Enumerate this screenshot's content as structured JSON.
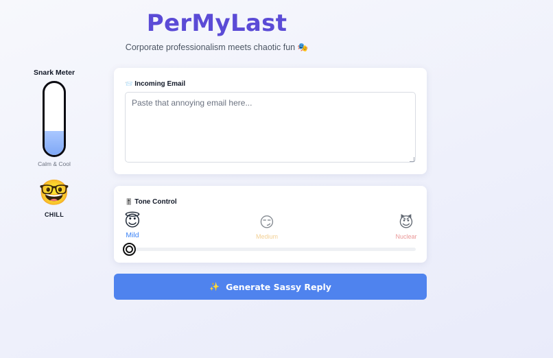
{
  "header": {
    "title": "PerMyLast",
    "subtitle": "Corporate professionalism meets chaotic fun 🎭"
  },
  "snark_meter": {
    "title": "Snark Meter",
    "level": 0.33,
    "caption": "Calm & Cool",
    "mood_emoji": "🤓",
    "mood_label": "CHILL"
  },
  "email_card": {
    "icon": "📨",
    "label": "Incoming Email",
    "value": "",
    "placeholder": "Paste that annoying email here..."
  },
  "tone_card": {
    "icon": "🎚️",
    "label": "Tone Control",
    "options": [
      {
        "emoji": "😇",
        "label": "Mild",
        "selected": true
      },
      {
        "emoji": "😏",
        "label": "Medium",
        "selected": false
      },
      {
        "emoji": "😈",
        "label": "Nuclear",
        "selected": false
      }
    ],
    "slider_value": 0
  },
  "generate_button": {
    "icon": "✨",
    "label": "Generate Sassy Reply"
  },
  "colors": {
    "brand": "#5b4bd6",
    "button": "#4f83ee",
    "meter_fill": "#7fa8f6",
    "mild": "#3b82f6",
    "medium": "#e8a93b",
    "nuclear": "#e06a6a"
  }
}
